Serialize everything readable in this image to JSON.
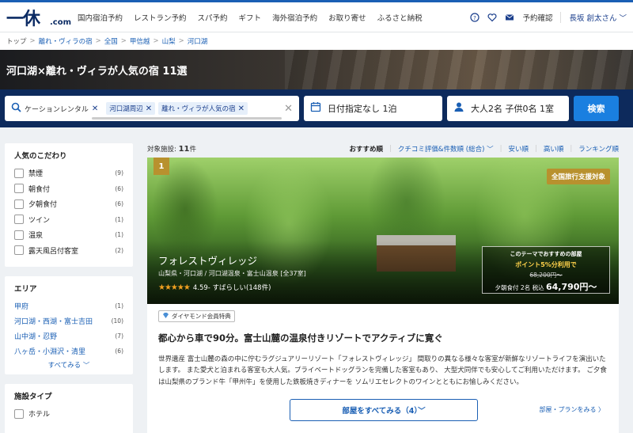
{
  "header": {
    "logo_main": "一休",
    "logo_domain": ".com",
    "nav": [
      "国内宿泊予約",
      "レストラン予約",
      "スパ予約",
      "ギフト",
      "海外宿泊予約",
      "お取り寄せ",
      "ふるさと納税"
    ],
    "reservation_label": "予約確認",
    "user_label": "長坂 創太さん ﹀"
  },
  "breadcrumb": [
    "トップ",
    "離れ・ヴィラの宿",
    "全国",
    "甲信越",
    "山梨",
    "河口湖"
  ],
  "hero_title": "河口湖×離れ・ヴィラが人気の宿 11選",
  "search": {
    "keyword_text": "ケーションレンタル",
    "chips": [
      "河口湖周辺",
      "離れ・ヴィラが人気の宿"
    ],
    "date_label": "日付指定なし 1泊",
    "people_label": "大人2名 子供0名 1室",
    "button_label": "検索"
  },
  "sidebar": {
    "popular_title": "人気のこだわり",
    "popular_items": [
      {
        "label": "禁煙",
        "count": "(9)"
      },
      {
        "label": "朝食付",
        "count": "(6)"
      },
      {
        "label": "夕朝食付",
        "count": "(6)"
      },
      {
        "label": "ツイン",
        "count": "(1)"
      },
      {
        "label": "温泉",
        "count": "(1)"
      },
      {
        "label": "露天風呂付客室",
        "count": "(2)"
      }
    ],
    "area_title": "エリア",
    "area_items": [
      {
        "label": "甲府",
        "count": "(1)"
      },
      {
        "label": "河口湖・西湖・富士吉田",
        "count": "(10)"
      },
      {
        "label": "山中湖・忍野",
        "count": "(7)"
      },
      {
        "label": "八ヶ岳・小淵沢・清里",
        "count": "(6)"
      }
    ],
    "see_all": "すべてみる ﹀",
    "type_title": "施設タイプ",
    "type_items": [
      {
        "label": "ホテル"
      }
    ]
  },
  "results": {
    "count_prefix": "対象施設:",
    "count_value": "11",
    "count_suffix": "件",
    "sort_active": "おすすめ順",
    "sort_links": [
      "クチコミ評価&件数順 (総合) ﹀",
      "安い順",
      "高い順",
      "ランキング順"
    ]
  },
  "hotel": {
    "rank": "1",
    "badge": "全国旅行支援対象",
    "name": "フォレストヴィレッジ",
    "location": "山梨県・河口湖 / 河口湖温泉・富士山温泉 [全37室]",
    "stars": "★★★★★",
    "rating_text": "4.59- すばらしい(148件)",
    "price_theme": "このテーマでおすすめの部屋",
    "price_point": "ポイント5%分利用で",
    "price_old": "68,200円〜",
    "price_now_prefix": "夕朝食付 2名 税込",
    "price_now": "64,790円〜",
    "diamond_label": "ダイヤモンド会員特典",
    "headline": "都心から車で90分。富士山麓の温泉付きリゾートでアクティブに寛ぐ",
    "description": "世界遺産 富士山麓の森の中に佇むラグジュアリーリゾート「フォレストヴィレッジ」 間取りの異なる様々な客室が新鮮なリゾートライフを演出いたします。 また愛犬と泊まれる客室も大人気。プライベートドッグランを完備した客室もあり、 大型犬同伴でも安心してご利用いただけます。 ご夕食は山梨県のブランド牛「甲州牛」を使用した鉄板焼きディナーを ソムリエセレクトのワインとともにお愉しみください。",
    "rooms_button": "部屋をすべてみる（4）﹀",
    "plan_link": "部屋・プランをみる 〉"
  }
}
